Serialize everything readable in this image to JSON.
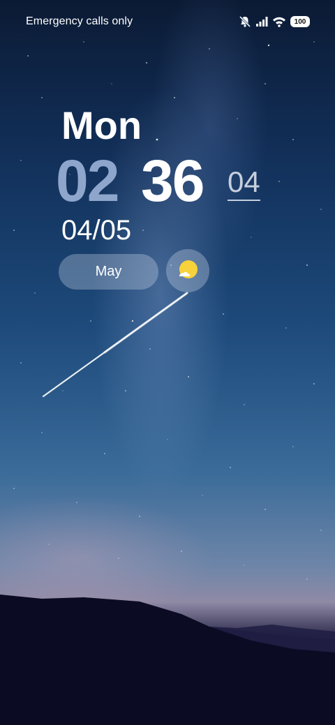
{
  "status_bar": {
    "carrier_text": "Emergency calls only",
    "battery_level": "100"
  },
  "lock_screen": {
    "day": "Mon",
    "hour": "02",
    "minute": "36",
    "seconds": "04",
    "date": "04/05",
    "month_chip": "May"
  },
  "icons": {
    "mute": "bell-off-icon",
    "signal": "signal-icon",
    "wifi": "wifi-icon",
    "weather": "partly-cloudy-sun-icon"
  },
  "colors": {
    "hour": "#8fa6cc",
    "minute": "#ffffff",
    "sun": "#f7d23a"
  }
}
